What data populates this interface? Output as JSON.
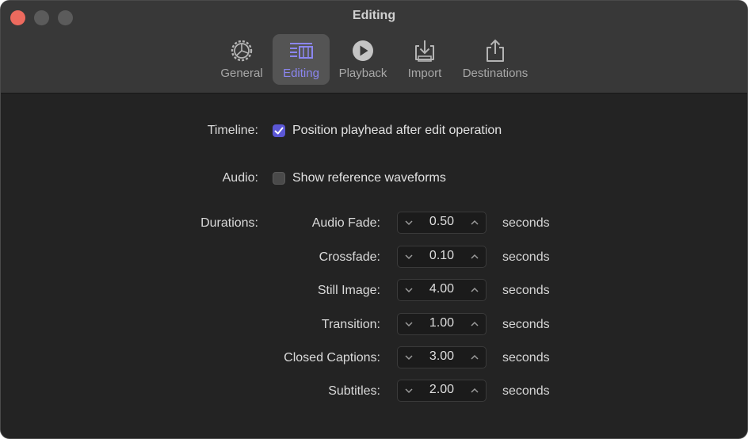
{
  "window": {
    "title": "Editing"
  },
  "toolbar": {
    "tabs": [
      {
        "label": "General",
        "icon": "gear-icon"
      },
      {
        "label": "Editing",
        "icon": "editing-icon",
        "selected": true
      },
      {
        "label": "Playback",
        "icon": "play-icon"
      },
      {
        "label": "Import",
        "icon": "import-icon"
      },
      {
        "label": "Destinations",
        "icon": "share-icon"
      }
    ]
  },
  "timeline": {
    "label": "Timeline:",
    "option": "Position playhead after edit operation",
    "checked": true
  },
  "audio": {
    "label": "Audio:",
    "option": "Show reference waveforms",
    "checked": false
  },
  "durations": {
    "label": "Durations:",
    "unit": "seconds",
    "rows": [
      {
        "label": "Audio Fade:",
        "value": "0.50"
      },
      {
        "label": "Crossfade:",
        "value": "0.10"
      },
      {
        "label": "Still Image:",
        "value": "4.00"
      },
      {
        "label": "Transition:",
        "value": "1.00"
      },
      {
        "label": "Closed Captions:",
        "value": "3.00"
      },
      {
        "label": "Subtitles:",
        "value": "2.00"
      }
    ]
  },
  "colors": {
    "accent": "#5b57d6",
    "accent_text": "#8b86f0",
    "close_button": "#ed6a5e",
    "background": "#232323",
    "toolbar": "#383838"
  }
}
